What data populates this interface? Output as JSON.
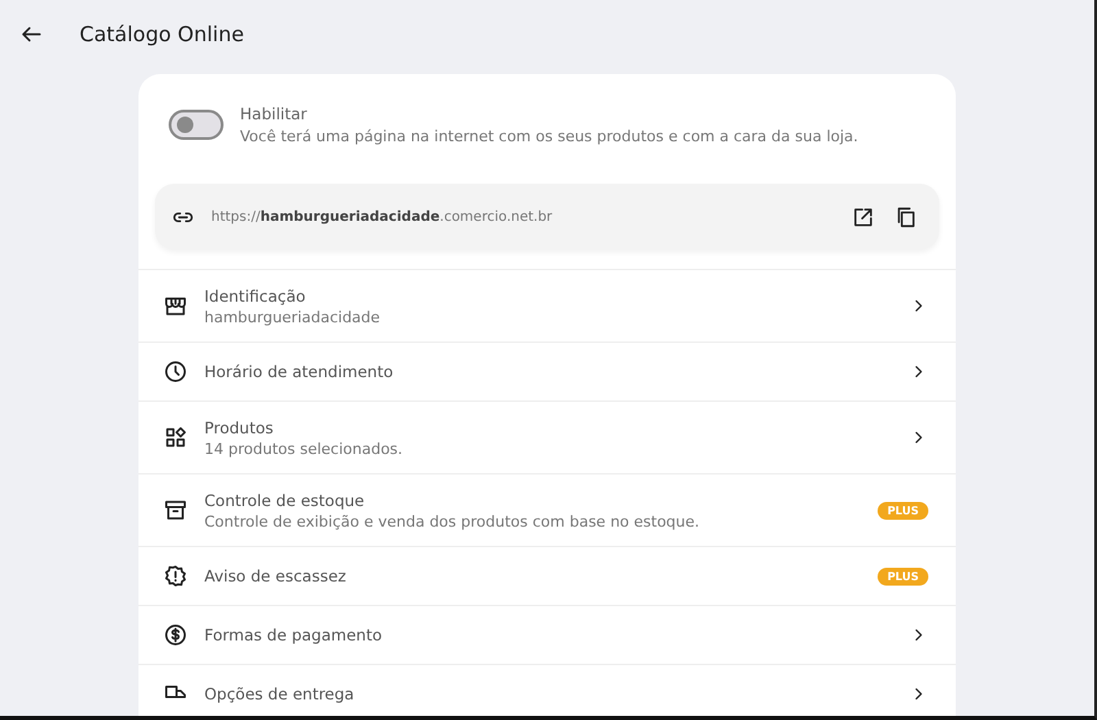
{
  "header": {
    "title": "Catálogo Online"
  },
  "enable": {
    "label": "Habilitar",
    "description": "Você terá uma página na internet com os seus produtos e com a cara da sua loja.",
    "on": false
  },
  "url": {
    "text": "https://**hamburgueriadacidade**.comercio.net.br"
  },
  "items": [
    {
      "title": "Identificação",
      "subtitle": "hamburgueriadacidade",
      "kind": "link"
    },
    {
      "title": "Horário de atendimento",
      "kind": "link"
    },
    {
      "title": "Produtos",
      "subtitle": "14 produtos selecionados.",
      "kind": "link"
    },
    {
      "title": "Controle de estoque",
      "subtitle": "Controle de exibição e venda dos produtos com base no estoque.",
      "kind": "plus",
      "badge": "PLUS"
    },
    {
      "title": "Aviso de escassez",
      "kind": "plus",
      "badge": "PLUS"
    },
    {
      "title": "Formas de pagamento",
      "kind": "link"
    },
    {
      "title": "Opções de entrega",
      "kind": "link"
    }
  ]
}
